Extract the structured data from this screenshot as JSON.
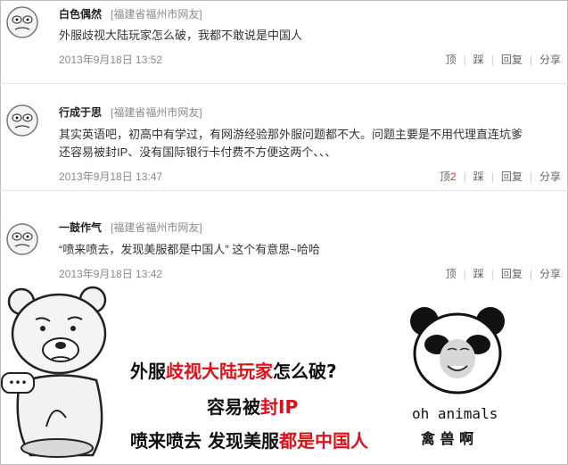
{
  "comments": [
    {
      "username": "白色偶然",
      "location": "[福建省福州市网友]",
      "text": "外服歧视大陆玩家怎么破，我都不敢说是中国人",
      "time": "2013年9月18日 13:52",
      "actions": {
        "up": "顶",
        "up_count": "",
        "down": "踩",
        "reply": "回复",
        "share": "分享"
      }
    },
    {
      "username": "行成于思",
      "location": "[福建省福州市网友]",
      "text_line1": "其实英语吧，初高中有学过，有网游经验那外服问题都不大。问题主要是不用代理直连坑爹",
      "text_line2": "还容易被封IP、没有国际银行卡付费不方便这两个、、、",
      "time": "2013年9月18日 13:47",
      "actions": {
        "up": "顶",
        "up_count": "2",
        "down": "踩",
        "reply": "回复",
        "share": "分享"
      }
    },
    {
      "username": "一鼓作气",
      "location": "[福建省福州市网友]",
      "text": "“喷来喷去，发现美服都是中国人” 这个有意思~哈哈",
      "time": "2013年9月18日 13:42",
      "actions": {
        "up": "顶",
        "up_count": "",
        "down": "踩",
        "reply": "回复",
        "share": "分享"
      }
    }
  ],
  "meme": {
    "line1_a": "外服",
    "line1_hl": "歧视大陆玩家",
    "line1_b": "怎么破?",
    "line2_a": "容易被",
    "line2_hl": "封IP",
    "line3_a": "喷来喷去 发现美服",
    "line3_hl": "都是中国人",
    "bear_speech": "•••",
    "panda_caption": "oh animals",
    "panda_caption_cn": "禽 兽 啊"
  },
  "colors": {
    "highlight": "#e0101a",
    "meta_gray": "#8a8a8a",
    "up_count_red": "#e23030"
  },
  "icons": [
    "rage-face-avatar-icon",
    "bear-meme-icon",
    "panda-meme-icon"
  ]
}
